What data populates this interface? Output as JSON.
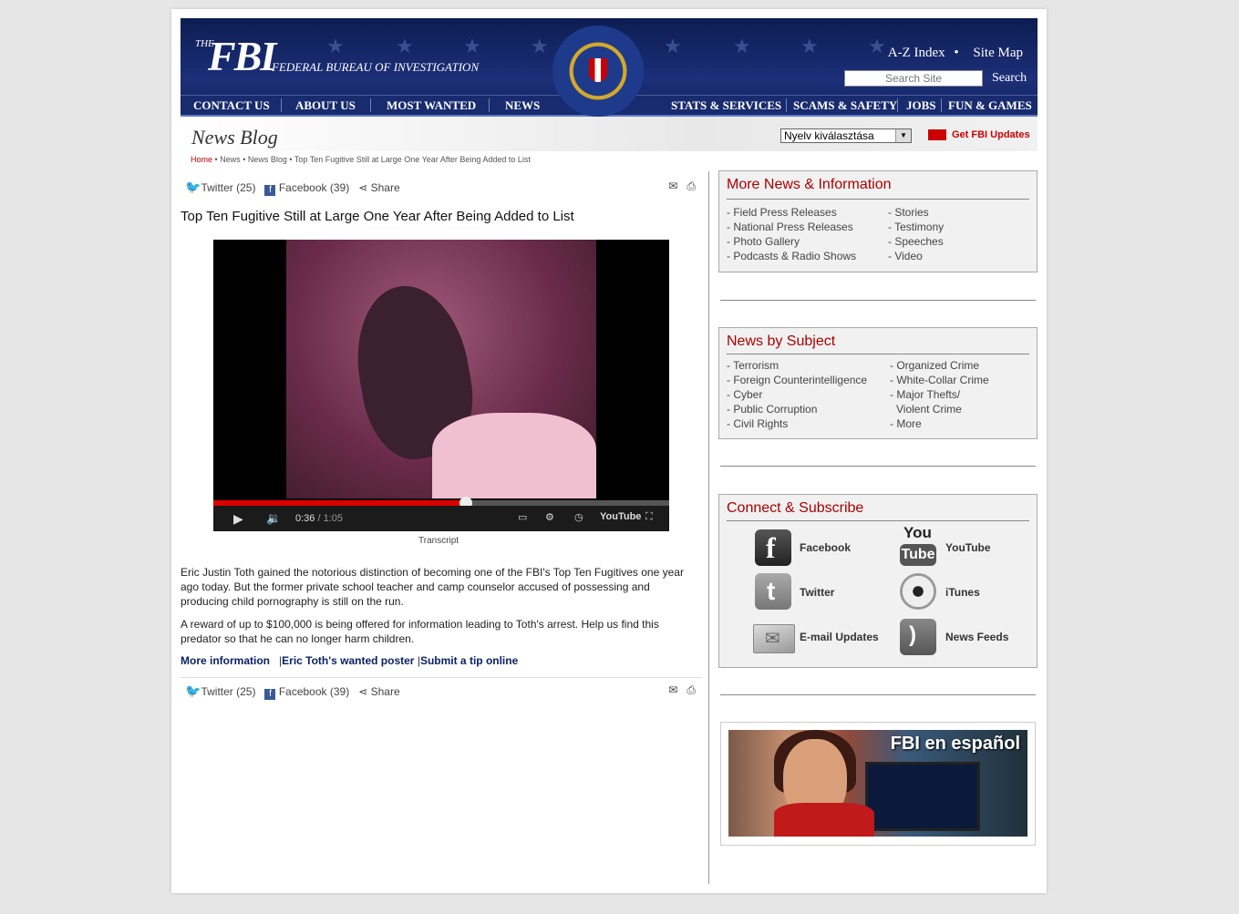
{
  "header": {
    "logo_the": "THE",
    "logo_fbi": "FBI",
    "logo_sub": "FEDERAL BUREAU OF INVESTIGATION",
    "az_index": "A-Z Index",
    "bullet": "•",
    "site_map": "Site Map",
    "search_placeholder": "Search Site",
    "search_button": "Search",
    "nav_left": [
      "CONTACT US",
      "ABOUT US",
      "MOST WANTED",
      "NEWS"
    ],
    "nav_right": [
      "STATS & SERVICES",
      "SCAMS & SAFETY",
      "JOBS",
      "FUN & GAMES"
    ],
    "section_title": "News Blog",
    "language_select": "Nyelv kiválasztása",
    "get_updates": "Get FBI Updates"
  },
  "breadcrumb": {
    "home": "Home",
    "news": "News",
    "news_blog": "News Blog",
    "current": "Top Ten Fugitive Still at Large One Year After Being Added to List",
    "sep": " • "
  },
  "share_bar": {
    "twitter": "Twitter (25)",
    "facebook": "Facebook (39)",
    "share": "Share"
  },
  "article": {
    "title": "Top Ten Fugitive Still at Large One Year After Being Added to List",
    "video_time": "0:36",
    "video_duration": "/ 1:05",
    "video_progress": 0.554,
    "transcript": "Transcript",
    "para1": "Eric Justin Toth gained the notorious distinction of becoming one of the FBI's Top Ten Fugitives one year ago today. But the former private school teacher and camp counselor accused of possessing and producing child pornography is still on the run.",
    "para2": "A reward of up to $100,000 is being offered for information leading to Toth's arrest. Help us find this predator so that he can no longer harm children.",
    "link1": "More information",
    "link2": "Eric Toth's wanted poster",
    "link3": "Submit a tip online",
    "link_sep": "|"
  },
  "more_news": {
    "title": "More News & Information",
    "left": [
      "- Field Press Releases",
      "- National Press Releases",
      "- Photo Gallery",
      "- Podcasts & Radio Shows"
    ],
    "right": [
      "- Stories",
      "- Testimony",
      "- Speeches",
      "- Video"
    ]
  },
  "news_by_subject": {
    "title": "News by Subject",
    "left": [
      "- Terrorism",
      "- Foreign Counterintelligence",
      "- Cyber",
      "- Public Corruption",
      "- Civil Rights"
    ],
    "right": [
      "- Organized Crime",
      "- White-Collar Crime",
      "- Major Thefts/",
      "Violent Crime",
      "- More"
    ]
  },
  "connect": {
    "title": "Connect & Subscribe",
    "items": [
      "Facebook",
      "YouTube",
      "Twitter",
      "iTunes",
      "E-mail Updates",
      "News Feeds"
    ],
    "youtube_you": "You",
    "youtube_tube": "Tube"
  },
  "promo": {
    "text": "FBI en español"
  }
}
